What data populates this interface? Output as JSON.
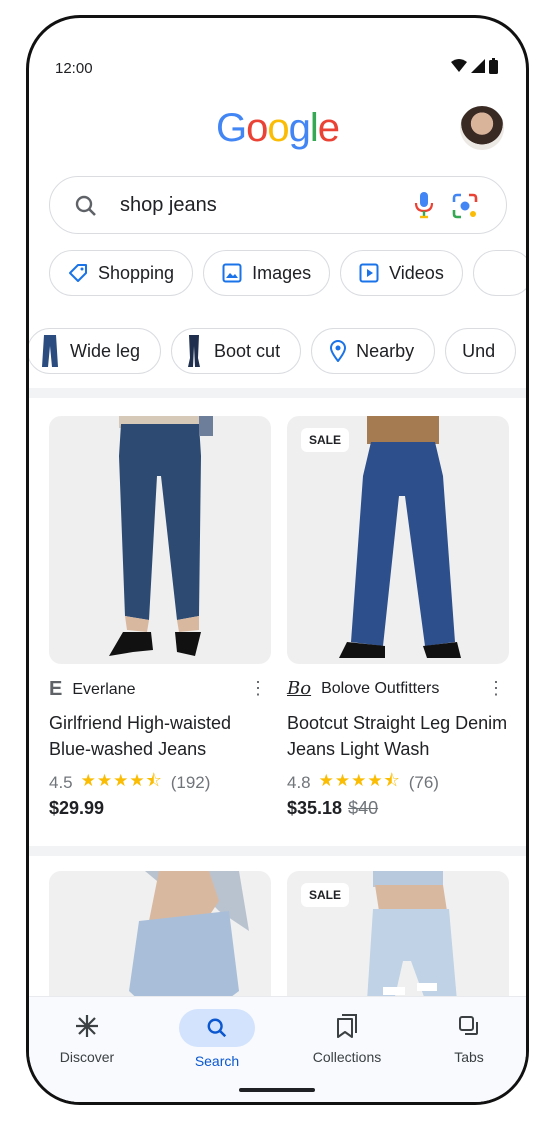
{
  "status": {
    "time": "12:00"
  },
  "logo": {
    "letters": [
      "G",
      "o",
      "o",
      "g",
      "l",
      "e"
    ],
    "colors": [
      "#4285F4",
      "#EA4335",
      "#FBBC05",
      "#4285F4",
      "#34A853",
      "#EA4335"
    ]
  },
  "search": {
    "query": "shop jeans"
  },
  "filters": [
    {
      "label": "Shopping",
      "icon": "tag-icon"
    },
    {
      "label": "Images",
      "icon": "image-icon"
    },
    {
      "label": "Videos",
      "icon": "play-icon"
    }
  ],
  "refinements": [
    {
      "label": "Wide leg",
      "icon": "jeans-thumbnail"
    },
    {
      "label": "Boot cut",
      "icon": "jeans-thumbnail"
    },
    {
      "label": "Nearby",
      "icon": "location-pin-icon"
    },
    {
      "label": "Und"
    }
  ],
  "products": [
    {
      "merchant": "Everlane",
      "logo": "E",
      "title": "Girlfriend High-waisted Blue-washed Jeans",
      "rating": "4.5",
      "reviews": "(192)",
      "price": "$29.99",
      "old_price": "",
      "sale": ""
    },
    {
      "merchant": "Bolove Outfitters",
      "logo": "Bo",
      "title": "Bootcut Straight Leg Denim Jeans Light Wash",
      "rating": "4.8",
      "reviews": "(76)",
      "price": "$35.18",
      "old_price": "$40",
      "sale": "SALE"
    },
    {
      "sale": ""
    },
    {
      "sale": "SALE"
    }
  ],
  "nav": [
    {
      "label": "Discover",
      "icon": "asterisk-icon"
    },
    {
      "label": "Search",
      "icon": "search-icon"
    },
    {
      "label": "Collections",
      "icon": "collections-icon"
    },
    {
      "label": "Tabs",
      "icon": "tabs-icon"
    }
  ],
  "colors": {
    "accent": "#0b57d0",
    "star": "#fbbc04",
    "nav_active": "#d3e3fd"
  }
}
